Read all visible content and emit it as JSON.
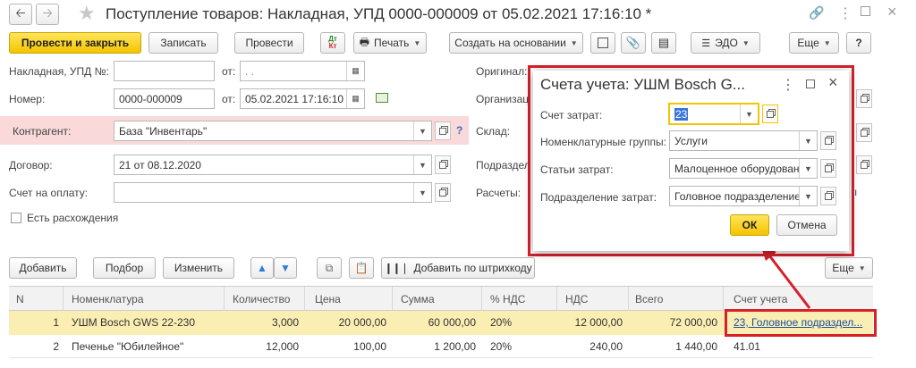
{
  "window": {
    "title": "Поступление товаров: Накладная, УПД 0000-000009 от 05.02.2021 17:16:10 *"
  },
  "toolbar": {
    "post_close": "Провести и закрыть",
    "save": "Записать",
    "post": "Провести",
    "dt_kt_top": "Дт",
    "dt_kt_bottom": "Кт",
    "print": "Печать",
    "create_based": "Создать на основании",
    "edo": "ЭДО",
    "more": "Еще",
    "help": "?"
  },
  "form": {
    "invoice_label": "Накладная, УПД №:",
    "invoice_value": "",
    "from_label": "от:",
    "invoice_date": " .  .",
    "number_label": "Номер:",
    "number_value": "0000-000009",
    "number_date": "05.02.2021 17:16:10",
    "counterparty_label": "Контрагент:",
    "counterparty_value": "База \"Инвентарь\"",
    "contract_label": "Договор:",
    "contract_value": "21 от 08.12.2020",
    "payment_label": "Счет на оплату:",
    "payment_value": "",
    "discrepancy_label": "Есть расхождения",
    "original_label": "Оригинал:",
    "organization_label": "Организац",
    "warehouse_label": "Склад:",
    "division_label": "Подраздел",
    "settlements_label": "Расчеты:"
  },
  "table_toolbar": {
    "add": "Добавить",
    "pick": "Подбор",
    "change": "Изменить",
    "barcode": "Добавить по штрихкоду",
    "more": "Еще"
  },
  "table": {
    "headers": [
      "N",
      "Номенклатура",
      "Количество",
      "Цена",
      "Сумма",
      "% НДС",
      "НДС",
      "Всего",
      "Счет учета"
    ],
    "rows": [
      {
        "n": "1",
        "item": "УШМ Bosch GWS 22-230",
        "qty": "3,000",
        "price": "20 000,00",
        "sum": "60 000,00",
        "vat_rate": "20%",
        "vat": "12 000,00",
        "total": "72 000,00",
        "account": "23, Головное подраздел..."
      },
      {
        "n": "2",
        "item": "Печенье \"Юбилейное\"",
        "qty": "12,000",
        "price": "100,00",
        "sum": "1 200,00",
        "vat_rate": "20%",
        "vat": "240,00",
        "total": "1 440,00",
        "account": "41.01"
      }
    ]
  },
  "dialog": {
    "title": "Счета учета: УШМ Bosch G...",
    "cost_account_label": "Счет затрат:",
    "cost_account_value": "23",
    "nomenclature_groups_label": "Номенклатурные группы:",
    "nomenclature_groups_value": "Услуги",
    "cost_items_label": "Статьи затрат:",
    "cost_items_value": "Малоценное оборудовани",
    "cost_division_label": "Подразделение затрат:",
    "cost_division_value": "Головное подразделение",
    "ok": "ОК",
    "cancel": "Отмена"
  },
  "colors": {
    "accent_yellow": "#f5c400",
    "highlight_red": "#d4212a",
    "row_selected": "#fbeeb3",
    "counterparty_bg": "#f9d9d9",
    "link_blue": "#1a4fa0"
  }
}
